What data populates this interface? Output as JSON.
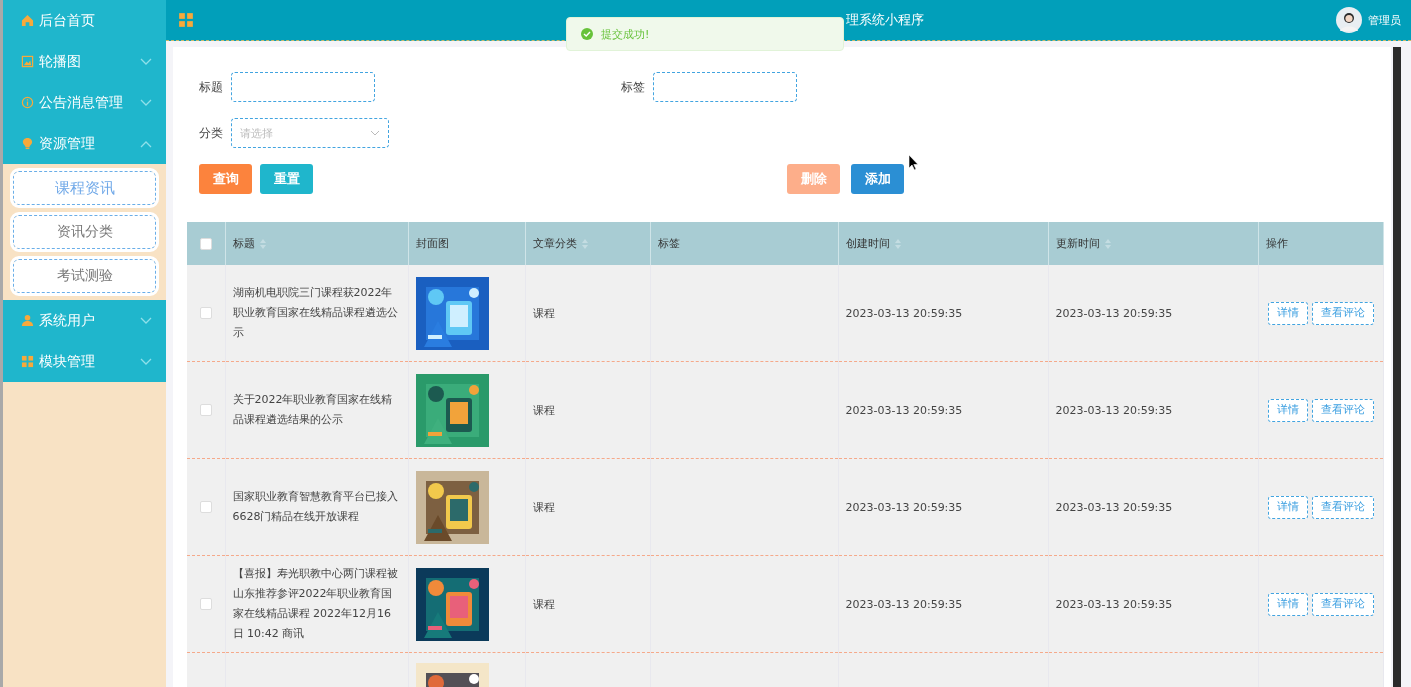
{
  "sidebar": {
    "items": [
      {
        "label": "后台首页",
        "expandable": false
      },
      {
        "label": "轮播图",
        "expanded": false,
        "expandable": true
      },
      {
        "label": "公告消息管理",
        "expanded": false,
        "expandable": true
      },
      {
        "label": "资源管理",
        "expanded": true,
        "expandable": true,
        "children": [
          {
            "label": "课程资讯",
            "selected": true
          },
          {
            "label": "资讯分类",
            "selected": false
          },
          {
            "label": "考试测验",
            "selected": false
          }
        ]
      },
      {
        "label": "系统用户",
        "expanded": false,
        "expandable": true
      },
      {
        "label": "模块管理",
        "expanded": false,
        "expandable": true
      }
    ]
  },
  "header": {
    "title": "理系统小程序",
    "user": "管理员"
  },
  "toast": {
    "message": "提交成功!"
  },
  "filters": {
    "title_label": "标题",
    "tag_label": "标签",
    "category_label": "分类",
    "category_placeholder": "请选择"
  },
  "buttons": {
    "query": "查询",
    "reset": "重置",
    "delete": "删除",
    "add": "添加",
    "delete_disabled": true
  },
  "table": {
    "select_all_checked": false,
    "columns": [
      {
        "label": "标题",
        "sortable": true
      },
      {
        "label": "封面图",
        "sortable": false
      },
      {
        "label": "文章分类",
        "sortable": true
      },
      {
        "label": "标签",
        "sortable": false
      },
      {
        "label": "创建时间",
        "sortable": true
      },
      {
        "label": "更新时间",
        "sortable": true
      },
      {
        "label": "操作",
        "sortable": false
      }
    ],
    "rows": [
      {
        "checked": false,
        "title": "湖南机电职院三门课程获2022年职业教育国家在线精品课程遴选公示",
        "cover": {
          "kind": "picture"
        },
        "category": "课程",
        "created": "2023-03-13 20:59:35",
        "updated": "2023-03-13 20:59:35",
        "actions": [
          "详情",
          "查看评论"
        ]
      },
      {
        "checked": false,
        "title": "关于2022年职业教育国家在线精品课程遴选结果的公示",
        "cover": {
          "kind": "picture"
        },
        "category": "课程",
        "created": "2023-03-13 20:59:35",
        "updated": "2023-03-13 20:59:35",
        "actions": [
          "详情",
          "查看评论"
        ]
      },
      {
        "checked": false,
        "title": "国家职业教育智慧教育平台已接入6628门精品在线开放课程",
        "cover": {
          "kind": "picture"
        },
        "category": "课程",
        "created": "2023-03-13 20:59:35",
        "updated": "2023-03-13 20:59:35",
        "actions": [
          "详情",
          "查看评论"
        ]
      },
      {
        "checked": false,
        "title": "【喜报】寿光职教中心两门课程被山东推荐参评2022年职业教育国家在线精品课程 2022年12月16日 10:42 商讯",
        "cover": {
          "kind": "picture"
        },
        "category": "课程",
        "created": "2023-03-13 20:59:35",
        "updated": "2023-03-13 20:59:35",
        "actions": [
          "详情",
          "查看评论"
        ]
      }
    ],
    "partial_row": {
      "cover": {
        "kind": "picture"
      }
    }
  }
}
